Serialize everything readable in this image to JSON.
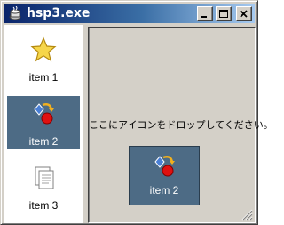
{
  "window": {
    "title": "hsp3.exe",
    "icon": "app-icon",
    "controls": [
      "minimize-icon",
      "maximize-icon",
      "close-icon"
    ]
  },
  "listview": {
    "items": [
      {
        "label": "item 1",
        "icon": "star-icon",
        "selected": false
      },
      {
        "label": "item 2",
        "icon": "shapes-icon",
        "selected": true
      },
      {
        "label": "item 3",
        "icon": "document-icon",
        "selected": false
      }
    ]
  },
  "droparea": {
    "message": "ここにアイコンをドロップしてください。",
    "dropped_item": {
      "label": "item 2",
      "icon": "shapes-icon"
    }
  },
  "colors": {
    "selection": "#4d6b85",
    "face": "#d4d0c8",
    "titlebar_start": "#0a246a"
  }
}
